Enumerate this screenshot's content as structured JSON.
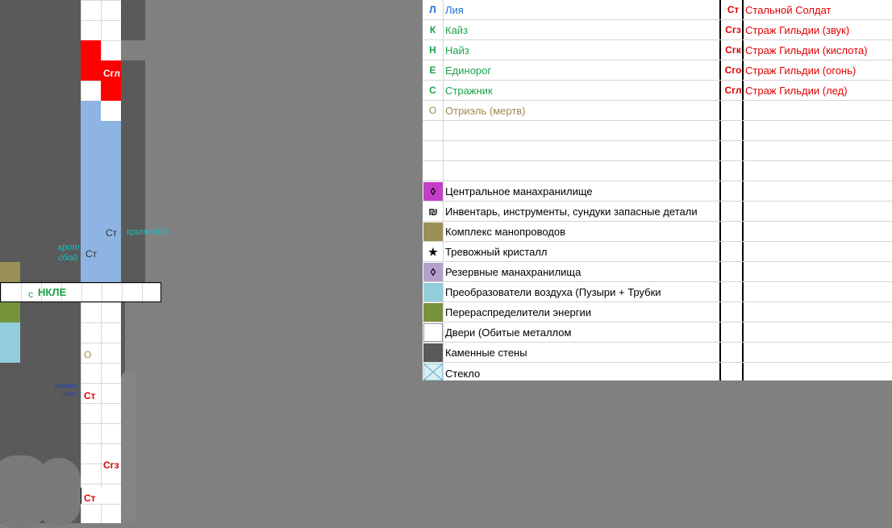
{
  "map": {
    "labels": {
      "sgl_top": "Сгл",
      "st_mid": "Ст",
      "st_left": "Ст",
      "krit_left_1": "крит",
      "krit_left_2": "сбой",
      "kritsboy_right": "критсбой",
      "party_s": "с",
      "party_nkle": "НКЛЕ",
      "o_marker": "О",
      "rzh_1": "ржавая",
      "rzh_2": "нозл",
      "st_low": "Ст",
      "sgz": "Сгз",
      "st_bottom": "Ст"
    }
  },
  "legend": {
    "members": [
      {
        "code": "Л",
        "name": "Лия",
        "color": "#1f6fd1"
      },
      {
        "code": "К",
        "name": "Кайз",
        "color": "#1aa34a"
      },
      {
        "code": "Н",
        "name": "Найз",
        "color": "#1aa34a"
      },
      {
        "code": "Е",
        "name": "Единорог",
        "color": "#1aa34a"
      },
      {
        "code": "С",
        "name": "Стражник",
        "color": "#1aa34a"
      },
      {
        "code": "О",
        "name": "Отриэль (мертв)",
        "color": "#9c8c4c"
      }
    ],
    "enemies": [
      {
        "code": "Ст",
        "name": "Стальной Солдат"
      },
      {
        "code": "Сгз",
        "name": "Страж Гильдии (звук)"
      },
      {
        "code": "Сгк",
        "name": "Страж Гильдии (кислота)"
      },
      {
        "code": "Сго",
        "name": "Страж Гильдии (огонь)"
      },
      {
        "code": "Сгл",
        "name": "Страж Гильдии (лед)"
      }
    ],
    "keys": [
      {
        "icon": "diamond-magenta-icon",
        "glyph": "◊",
        "text": "Центральное манахранилище",
        "swatch": "#c43fc7"
      },
      {
        "icon": "shekel-icon",
        "glyph": "₪",
        "text": "Инвентарь, инструменты, сундуки запасные детали",
        "swatch": "#ffffff"
      },
      {
        "icon": "olive-square-icon",
        "glyph": "",
        "text": "Комплекс манопроводов",
        "swatch": "#9b8f55"
      },
      {
        "icon": "star-icon",
        "glyph": "★",
        "text": "Тревожный кристалл",
        "swatch": "#ffffff"
      },
      {
        "icon": "diamond-lilac-icon",
        "glyph": "◊",
        "text": "Резервные манахранилища",
        "swatch": "#b3a0cc"
      },
      {
        "icon": "lightblue-square-icon",
        "glyph": "",
        "text": "Преобразователи воздуха (Пузыри + Трубки",
        "swatch": "#92cddc"
      },
      {
        "icon": "green-square-icon",
        "glyph": "",
        "text": "Перераспределители энергии",
        "swatch": "#77933c"
      },
      {
        "icon": "white-square-icon",
        "glyph": "",
        "text": "Двери (Обитые металлом",
        "swatch": "#ffffff"
      },
      {
        "icon": "gray-square-icon",
        "glyph": "",
        "text": "Каменные стены",
        "swatch": "#595959"
      },
      {
        "icon": "glass-cross-icon",
        "glyph": "",
        "text": "Стекло",
        "swatch": "#dbeef4"
      }
    ]
  },
  "colors": {
    "enemy": "#e00000",
    "crit": "#12c3c3",
    "rust": "#1f3fc4",
    "corridor": "#8eb4e3",
    "ice": "#ff0000"
  }
}
